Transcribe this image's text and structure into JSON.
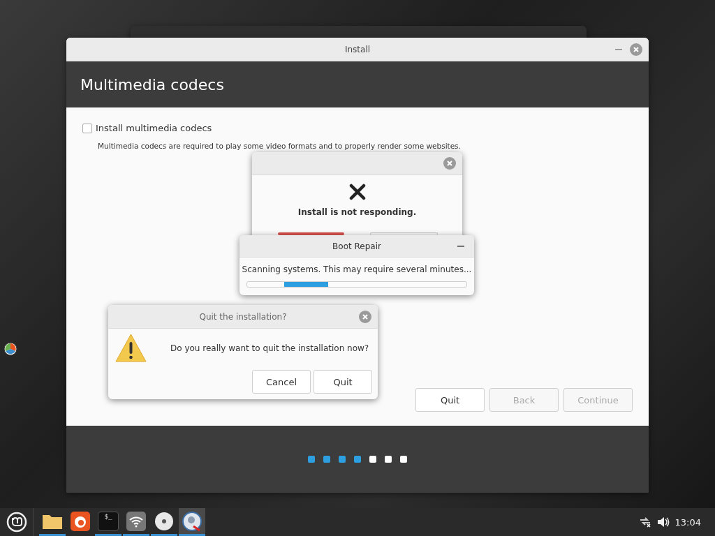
{
  "install_window": {
    "title": "Install",
    "heading": "Multimedia codecs",
    "option": {
      "label": "Install multimedia codecs",
      "checked": false
    },
    "description": "Multimedia codecs are required to play some video formats and to properly render some websites.",
    "buttons": [
      {
        "label": "Quit",
        "disabled": false
      },
      {
        "label": "Back",
        "disabled": true
      },
      {
        "label": "Continue",
        "disabled": true
      }
    ],
    "steps": [
      {
        "done": true
      },
      {
        "done": true
      },
      {
        "done": true
      },
      {
        "done": true
      },
      {
        "done": false
      },
      {
        "done": false
      },
      {
        "done": false
      }
    ]
  },
  "not_responding_dialog": {
    "message": "Install is not responding."
  },
  "boot_repair_window": {
    "title": "Boot Repair",
    "message": "Scanning systems. This may require several minutes...",
    "level": 0.2
  },
  "quit_dialog": {
    "title": "Quit the installation?",
    "message": "Do you really want to quit the installation now?",
    "buttons": [
      {
        "label": "Cancel"
      },
      {
        "label": "Quit"
      }
    ]
  },
  "taskbar": {
    "launchers": [
      {
        "kind": "folder",
        "running": true
      },
      {
        "kind": "browser",
        "running": false
      },
      {
        "kind": "terminal",
        "running": true,
        "label": "$_"
      },
      {
        "kind": "network",
        "running": true
      },
      {
        "kind": "disc",
        "running": true
      },
      {
        "kind": "repair",
        "running": true
      }
    ],
    "clock": "13:04"
  }
}
